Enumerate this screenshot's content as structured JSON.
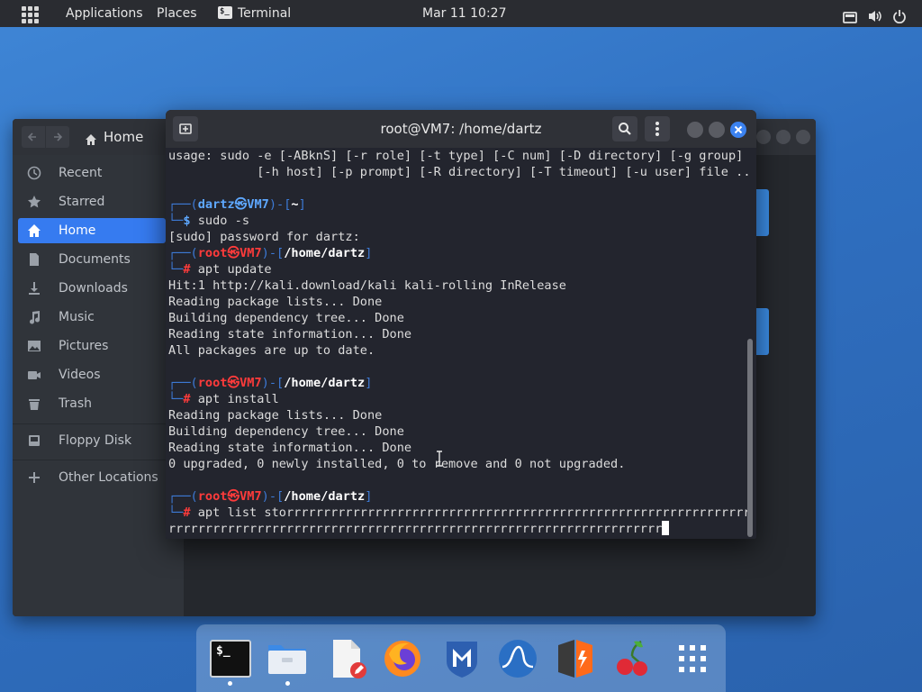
{
  "topbar": {
    "applications": "Applications",
    "places": "Places",
    "terminal_app": "Terminal",
    "datetime": "Mar 11  10:27"
  },
  "files": {
    "location": "Home",
    "sidebar": [
      {
        "label": "Recent",
        "icon": "clock-icon"
      },
      {
        "label": "Starred",
        "icon": "star-icon"
      },
      {
        "label": "Home",
        "icon": "home-icon"
      },
      {
        "label": "Documents",
        "icon": "document-icon"
      },
      {
        "label": "Downloads",
        "icon": "download-icon"
      },
      {
        "label": "Music",
        "icon": "music-icon"
      },
      {
        "label": "Pictures",
        "icon": "picture-icon"
      },
      {
        "label": "Videos",
        "icon": "video-icon"
      },
      {
        "label": "Trash",
        "icon": "trash-icon"
      },
      {
        "label": "Floppy Disk",
        "icon": "floppy-icon"
      },
      {
        "label": "Other Locations",
        "icon": "plus-icon"
      }
    ]
  },
  "terminal": {
    "title": "root@VM7: /home/dartz",
    "lines": {
      "l1": "usage: sudo -e [-ABknS] [-r role] [-t type] [-C num] [-D directory] [-g group]",
      "l2": "            [-h host] [-p prompt] [-R directory] [-T timeout] [-u user] file ...",
      "p1_user": "dartz",
      "p1_host": "VM7",
      "p1_dir": "~",
      "c1": "sudo -s",
      "o1": "[sudo] password for dartz:",
      "root_user": "root",
      "root_host": "VM7",
      "root_dir": "/home/dartz",
      "c2": "apt update",
      "o2a": "Hit:1 http://kali.download/kali kali-rolling InRelease",
      "o2b": "Reading package lists... Done",
      "o2c": "Building dependency tree... Done",
      "o2d": "Reading state information... Done",
      "o2e": "All packages are up to date.",
      "c3": "apt install",
      "o3a": "Reading package lists... Done",
      "o3b": "Building dependency tree... Done",
      "o3c": "Reading state information... Done",
      "o3d": "0 upgraded, 0 newly installed, 0 to remove and 0 not upgraded.",
      "c4": "apt list storrrrrrrrrrrrrrrrrrrrrrrrrrrrrrrrrrrrrrrrrrrrrrrrrrrrrrrrrrrrrrrrrrrrrr",
      "c4b": "rrrrrrrrrrrrrrrrrrrrrrrrrrrrrrrrrrrrrrrrrrrrrrrrrrrrrrrrrrrrrrrrrrr"
    }
  },
  "dock": [
    {
      "name": "terminal-icon"
    },
    {
      "name": "files-icon"
    },
    {
      "name": "text-editor-icon"
    },
    {
      "name": "firefox-icon"
    },
    {
      "name": "metasploit-icon"
    },
    {
      "name": "wireshark-icon"
    },
    {
      "name": "burpsuite-icon"
    },
    {
      "name": "cherrytree-icon"
    },
    {
      "name": "app-grid-icon"
    }
  ],
  "colors": {
    "accent": "#367bf0",
    "prompt_blue": "#5ea8ff",
    "root_red": "#ff3b3b"
  }
}
